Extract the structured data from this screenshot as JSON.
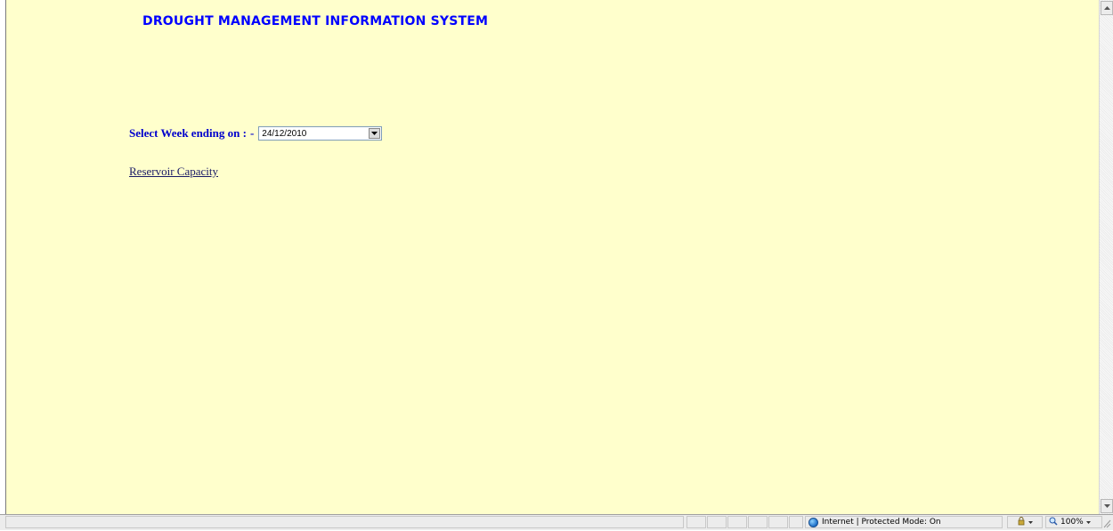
{
  "page": {
    "title": "DROUGHT MANAGEMENT INFORMATION SYSTEM",
    "background_color": "#ffffcc",
    "title_color": "#0000ff"
  },
  "week_selector": {
    "label": "Select Week ending on :",
    "suffix": "-",
    "selected_value": "24/12/2010",
    "icon": "chevron-down-icon"
  },
  "links": {
    "reservoir_capacity": "Reservoir Capacity"
  },
  "status_bar": {
    "zone_text": "Internet | Protected Mode: On",
    "zone_icon": "globe-icon",
    "security_icon": "lock-icon",
    "zoom": "100%",
    "zoom_icon": "zoom-icon"
  },
  "scrollbar": {
    "up_icon": "arrow-up-icon",
    "down_icon": "arrow-down-icon"
  }
}
